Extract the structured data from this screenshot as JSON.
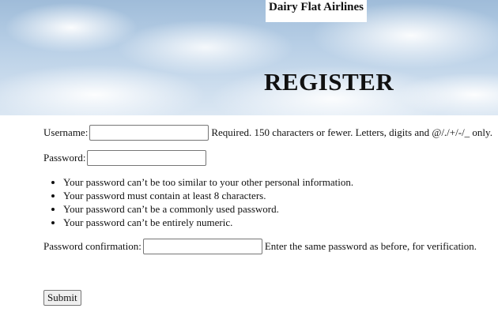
{
  "header": {
    "airline_name": "Dairy Flat Airlines",
    "page_title": "REGISTER"
  },
  "form": {
    "username": {
      "label": "Username:",
      "value": "",
      "help_text": "Required. 150 characters or fewer. Letters, digits and @/./+/-/_ only."
    },
    "password": {
      "label": "Password:",
      "value": "",
      "rules": [
        "Your password can’t be too similar to your other personal information.",
        "Your password must contain at least 8 characters.",
        "Your password can’t be a commonly used password.",
        "Your password can’t be entirely numeric."
      ]
    },
    "password_confirmation": {
      "label": "Password confirmation:",
      "value": "",
      "help_text": "Enter the same password as before, for verification."
    },
    "submit_label": "Submit"
  }
}
